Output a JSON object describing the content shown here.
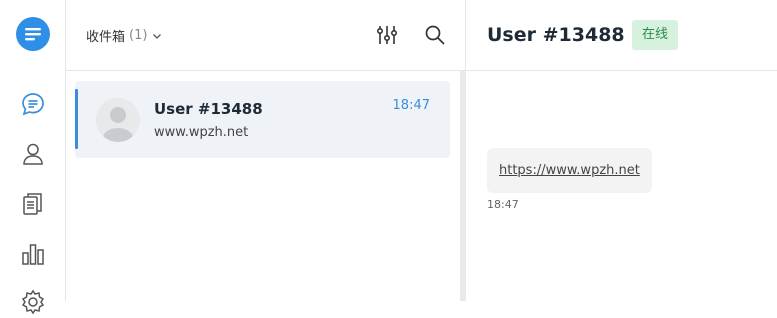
{
  "nav": {
    "items": [
      {
        "icon": "chat-icon",
        "active": true
      },
      {
        "icon": "user-icon",
        "active": false
      },
      {
        "icon": "documents-icon",
        "active": false
      },
      {
        "icon": "bar-chart-icon",
        "active": false
      },
      {
        "icon": "gear-icon",
        "active": false
      }
    ]
  },
  "list": {
    "inbox_label": "收件箱",
    "inbox_count": "(1)",
    "conversations": [
      {
        "name": "User #13488",
        "preview": "www.wpzh.net",
        "time": "18:47"
      }
    ]
  },
  "chat": {
    "title": "User #13488",
    "status": "在线",
    "messages": [
      {
        "text": "https://www.wpzh.net",
        "time": "18:47"
      }
    ]
  },
  "colors": {
    "accent": "#3d8ed8",
    "status_bg": "#d6f2df",
    "status_text": "#2e8b4a",
    "selected_bg": "#eff2f6"
  }
}
